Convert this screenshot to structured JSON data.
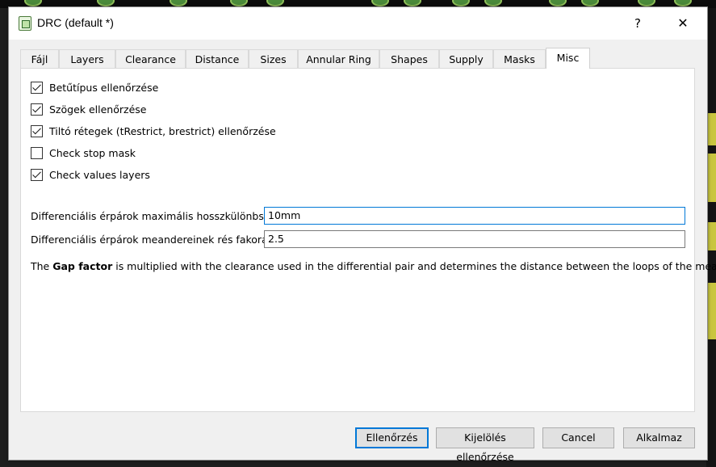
{
  "window": {
    "title": "DRC (default *)",
    "help_label": "?",
    "close_label": "✕"
  },
  "tabs": [
    {
      "label": "Fájl",
      "active": false
    },
    {
      "label": "Layers",
      "active": false
    },
    {
      "label": "Clearance",
      "active": false
    },
    {
      "label": "Distance",
      "active": false
    },
    {
      "label": "Sizes",
      "active": false
    },
    {
      "label": "Annular Ring",
      "active": false
    },
    {
      "label": "Shapes",
      "active": false
    },
    {
      "label": "Supply",
      "active": false
    },
    {
      "label": "Masks",
      "active": false
    },
    {
      "label": "Misc",
      "active": true
    }
  ],
  "misc": {
    "checkboxes": [
      {
        "label": "Betűtípus ellenőrzése",
        "checked": true
      },
      {
        "label": "Szögek ellenőrzése",
        "checked": true
      },
      {
        "label": "Tiltó rétegek (tRestrict, brestrict) ellenőrzése",
        "checked": true
      },
      {
        "label": "Check stop mask",
        "checked": false
      },
      {
        "label": "Check values layers",
        "checked": true
      }
    ],
    "diff_length": {
      "label": "Differenciális érpárok maximális hosszkülönbsége",
      "value": "10mm"
    },
    "gap_factor": {
      "label": "Differenciális érpárok meandereinek rés fakora",
      "value": "2.5"
    },
    "note": {
      "prefix": "The ",
      "bold": "Gap factor",
      "suffix": " is multiplied with the clearance used in the differential pair and determines the distance between the loops of the meander."
    }
  },
  "buttons": {
    "check": "Ellenőrzés",
    "check_selection": "Kijelölés ellenőrzése",
    "cancel": "Cancel",
    "apply": "Alkalmaz"
  },
  "colors": {
    "accent": "#0078d7",
    "dialog_bg": "#f0f0f0",
    "panel_bg": "#ffffff"
  }
}
